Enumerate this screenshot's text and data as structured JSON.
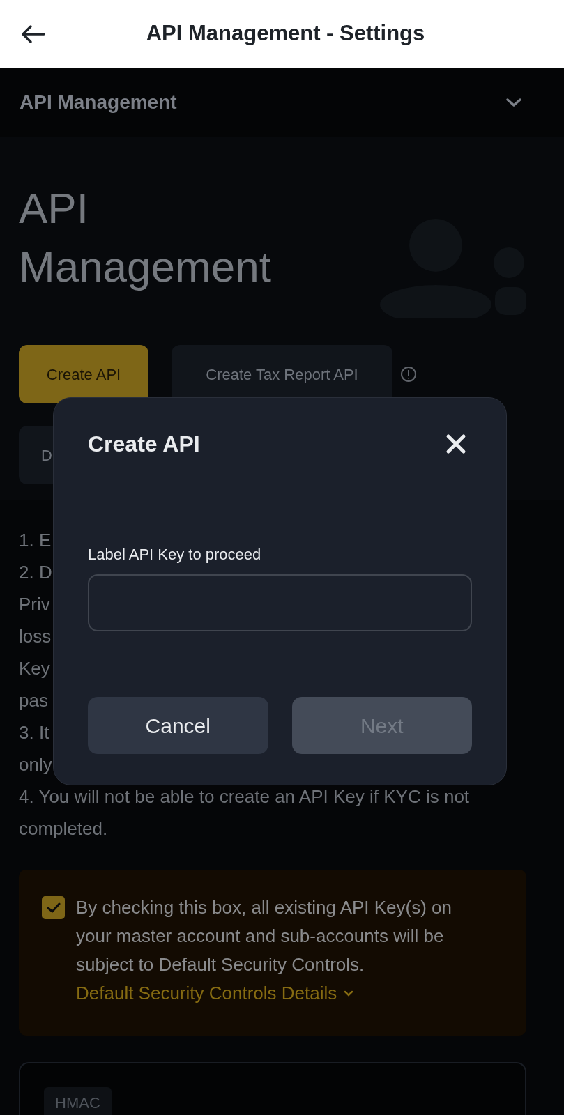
{
  "header": {
    "title": "API Management - Settings"
  },
  "section": {
    "title": "API Management"
  },
  "hero": {
    "title": "API Management",
    "buttons": [
      {
        "label": "Create API",
        "kind": "primary"
      },
      {
        "label": "Create Tax Report API",
        "kind": "secondary"
      }
    ],
    "second_row_button": {
      "label": "D"
    }
  },
  "instructions": [
    "1. E",
    "2. D",
    "Priv",
    "loss",
    "Key",
    "pas",
    "3. It",
    "only",
    "4. You will not be able to create an API Key if KYC is not completed."
  ],
  "notice": {
    "checked": true,
    "text": "By checking this box, all existing API Key(s) on your master account and sub-accounts will be subject to Default Security Controls.",
    "link": "Default Security Controls Details"
  },
  "key_card": {
    "tag": "HMAC"
  },
  "dialog": {
    "title": "Create API",
    "field_label": "Label API Key to proceed",
    "buttons": [
      {
        "label": "Cancel",
        "disabled": false
      },
      {
        "label": "Next",
        "disabled": true
      }
    ]
  }
}
